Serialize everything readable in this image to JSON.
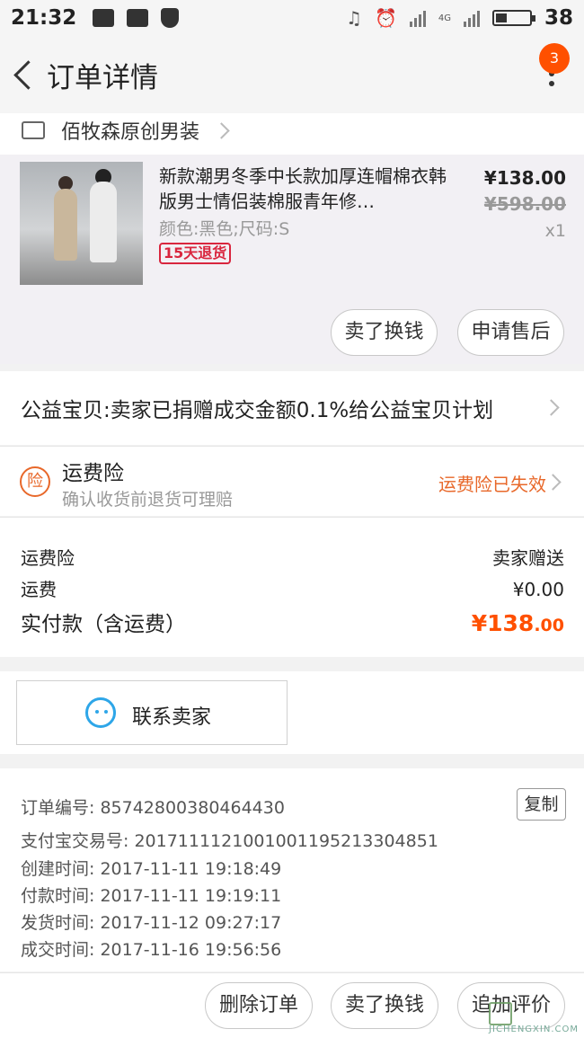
{
  "status_bar": {
    "time": "21:32",
    "network": "4G",
    "battery": "38"
  },
  "nav": {
    "title": "订单详情",
    "badge_count": "3"
  },
  "shop": {
    "name": "佰牧森原创男装"
  },
  "item": {
    "title": "新款潮男冬季中长款加厚连帽棉衣韩版男士情侣装棉服青年修…",
    "spec": "颜色:黑色;尺码:S",
    "refund_tag": "15天退货",
    "price": "¥138.00",
    "original_price": "¥598.00",
    "quantity": "x1",
    "sell_label": "卖了换钱",
    "after_sale_label": "申请售后"
  },
  "charity": {
    "text": "公益宝贝:卖家已捐赠成交金额0.1%给公益宝贝计划"
  },
  "insurance": {
    "icon_text": "险",
    "title": "运费险",
    "subtitle": "确认收货前退货可理赔",
    "status": "运费险已失效"
  },
  "fees": {
    "insurance_label": "运费险",
    "insurance_value": "卖家赠送",
    "shipping_label": "运费",
    "shipping_value": "¥0.00",
    "total_label": "实付款（含运费）",
    "total_main": "¥138",
    "total_cents": ".00"
  },
  "contact": {
    "label": "联系卖家"
  },
  "order_info": {
    "order_no": "订单编号: 85742800380464430",
    "copy_label": "复制",
    "alipay_no": "支付宝交易号: 2017111121001001195213304851",
    "created": "创建时间: 2017-11-11 19:18:49",
    "paid": "付款时间: 2017-11-11 19:19:11",
    "shipped": "发货时间: 2017-11-12 09:27:17",
    "completed": "成交时间: 2017-11-16 19:56:56"
  },
  "bottom_bar": {
    "delete_label": "删除订单",
    "sell_label": "卖了换钱",
    "review_label": "追加评价"
  },
  "watermark": "JICHENGXIN.COM",
  "colors": {
    "accent": "#ff5000",
    "insurance": "#e8682a",
    "refund_tag": "#d9263e",
    "wangwang": "#2ea6e8"
  }
}
